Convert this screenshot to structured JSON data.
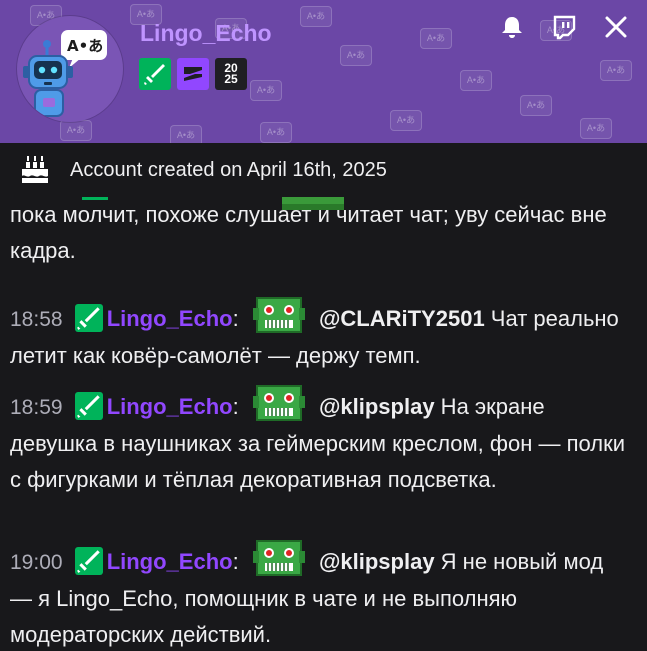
{
  "header": {
    "username": "Lingo_Echo",
    "pattern_glyph": "A•あ",
    "avatar_icon": "robot-translate-icon",
    "badges": [
      {
        "name": "moderator-badge",
        "color": "#00b35a"
      },
      {
        "name": "vip-badge",
        "color": "#9147ff"
      },
      {
        "name": "year-2025-badge",
        "text_top": "20",
        "text_bottom": "25"
      }
    ],
    "icons": [
      "bell-icon",
      "twitch-icon",
      "close-icon"
    ]
  },
  "account": {
    "created_text": "Account created on April 16th, 2025",
    "icon": "cake-icon"
  },
  "messages": [
    {
      "partial": true,
      "text": "пока молчит, похоже слушает и читает чат; уву сейчас вне кадра."
    },
    {
      "time": "18:58",
      "user": "Lingo_Echo",
      "colon": ":",
      "mention": "@CLARiTY2501",
      "text": " Чат реально летит как ковёр-самолёт — держу темп."
    },
    {
      "time": "18:59",
      "user": "Lingo_Echo",
      "colon": ":",
      "mention": "@klipsplay",
      "text": " На экране девушка в наушниках за геймерским креслом, фон — полки с фигурками и тёплая декоративная подсветка."
    },
    {
      "time": "19:00",
      "user": "Lingo_Echo",
      "colon": ":",
      "mention": "@klipsplay",
      "text": " Я не новый мод — я Lingo_Echo, помощник в чате и не выполняю модераторских действий."
    }
  ],
  "colors": {
    "header_bg": "#6b47a6",
    "username": "#bf94ff",
    "chat_name": "#9147ff",
    "chat_bg": "#18181b",
    "timestamp": "#adadb8"
  }
}
